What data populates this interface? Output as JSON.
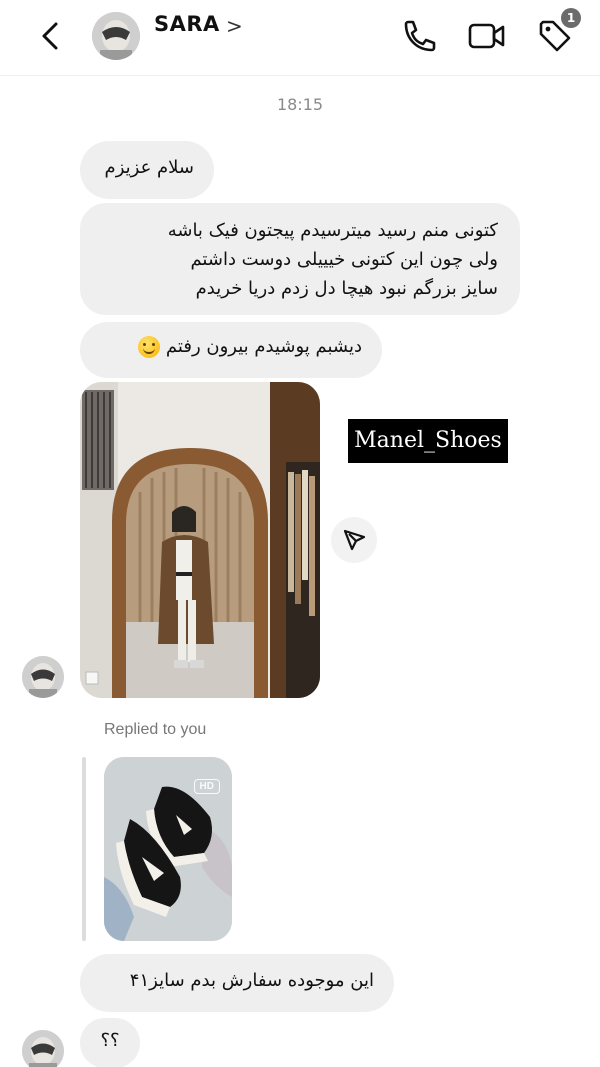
{
  "header": {
    "contact_name": "SARA",
    "chevron": ">",
    "subtitle": "",
    "icons": [
      "back-arrow-icon",
      "phone-icon",
      "video-call-icon",
      "tag-icon"
    ],
    "notification_count": "1"
  },
  "thread": {
    "timestamp": "18:15",
    "messages": [
      {
        "text": "سلام عزیزم"
      },
      {
        "lines": [
          "کتونی منم رسید میترسیدم پیجتون فیک باشه",
          "ولی چون این کتونی خیییلی دوست داشتم",
          "سایز بزرگم نبود هیچا دل زدم دریا خریدم"
        ]
      },
      {
        "text": "دیشبم پوشیدم بیرون رفتم",
        "emoji": "smiling-face-emoji"
      },
      {
        "image": "mirror-selfie-photo"
      },
      {
        "text": "این موجوده سفارش بدم سایز۴۱"
      },
      {
        "text": "؟؟"
      }
    ],
    "watermark": "Manel_Shoes",
    "reply": {
      "label": "Replied to you",
      "badge": "HD",
      "image": "sneakers-photo"
    }
  },
  "colors": {
    "bubble_bg": "#efefef",
    "text": "#111111",
    "meta_text": "#8a8a8a",
    "badge_bg": "#6b6b6b",
    "watermark_bg": "#000000"
  }
}
